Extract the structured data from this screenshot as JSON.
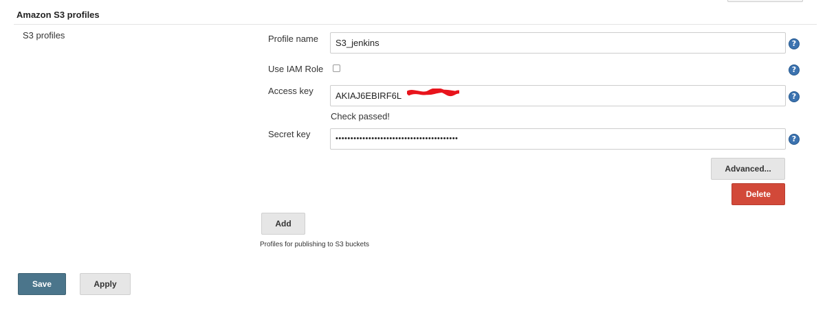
{
  "section": {
    "title": "Amazon S3 profiles",
    "group_label": "S3 profiles"
  },
  "profile": {
    "name_label": "Profile name",
    "name_value": "S3_jenkins",
    "iam_label": "Use IAM Role",
    "iam_checked": false,
    "access_label": "Access key",
    "access_value": "AKIAJ6EBIRF6L",
    "access_status": "Check passed!",
    "secret_label": "Secret key",
    "secret_value": "•••••••••••••••••••••••••••••••••••••••••",
    "advanced_button": "Advanced...",
    "delete_button": "Delete"
  },
  "add_button": "Add",
  "hint": "Profiles for publishing to S3 buckets",
  "footer": {
    "save_button": "Save",
    "apply_button": "Apply"
  },
  "icons": {
    "help": "help-icon",
    "help_glyph": "?"
  },
  "colors": {
    "save": "#4b758b",
    "delete": "#d24939",
    "help": "#3c73b0",
    "redaction": "#e8141c"
  }
}
